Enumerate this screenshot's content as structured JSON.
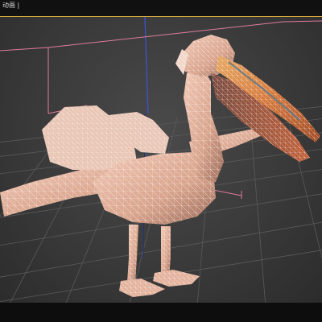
{
  "window": {
    "title": "动画 |"
  },
  "viewport": {
    "active_border_color": "#d6a640",
    "background_color": "#3d3d3d",
    "grid_color": "#555555",
    "bounding_box_color": "#e07b9e",
    "axis_color": "#3a56d8"
  },
  "model": {
    "name_icon": "pelican-wireframe-model",
    "body_color": "#e6b49f",
    "beak_color": "#d8773f",
    "wire_color": "#ffffff"
  }
}
